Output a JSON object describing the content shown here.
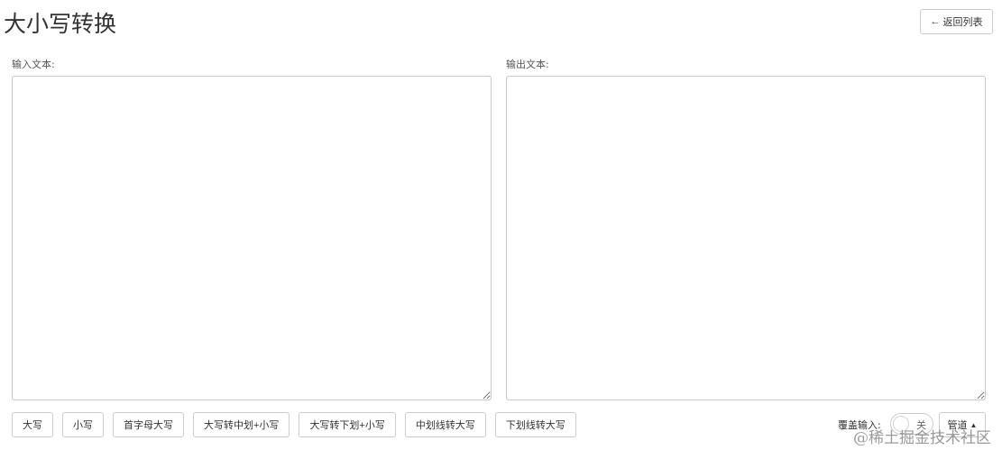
{
  "header": {
    "title": "大小写转换",
    "back_button": {
      "icon": "arrow-left-icon",
      "arrow": "←",
      "label": "返回列表"
    }
  },
  "input": {
    "label": "输入文本:",
    "value": ""
  },
  "output": {
    "label": "输出文本:",
    "value": ""
  },
  "toolbar": {
    "buttons": [
      {
        "label": "大写"
      },
      {
        "label": "小写"
      },
      {
        "label": "首字母大写"
      },
      {
        "label": "大写转中划+小写"
      },
      {
        "label": "大写转下划+小写"
      },
      {
        "label": "中划线转大写"
      },
      {
        "label": "下划线转大写"
      }
    ],
    "overwrite": {
      "label": "覆盖输入:",
      "toggle_text": "关",
      "checked": false
    },
    "pipe": {
      "label": "管道",
      "icon": "caret-up-icon",
      "caret": "▲"
    }
  },
  "watermark": {
    "text": "@稀土掘金技术社区"
  },
  "colors": {
    "border": "#cccccc",
    "text": "#333333",
    "background": "#ffffff"
  }
}
